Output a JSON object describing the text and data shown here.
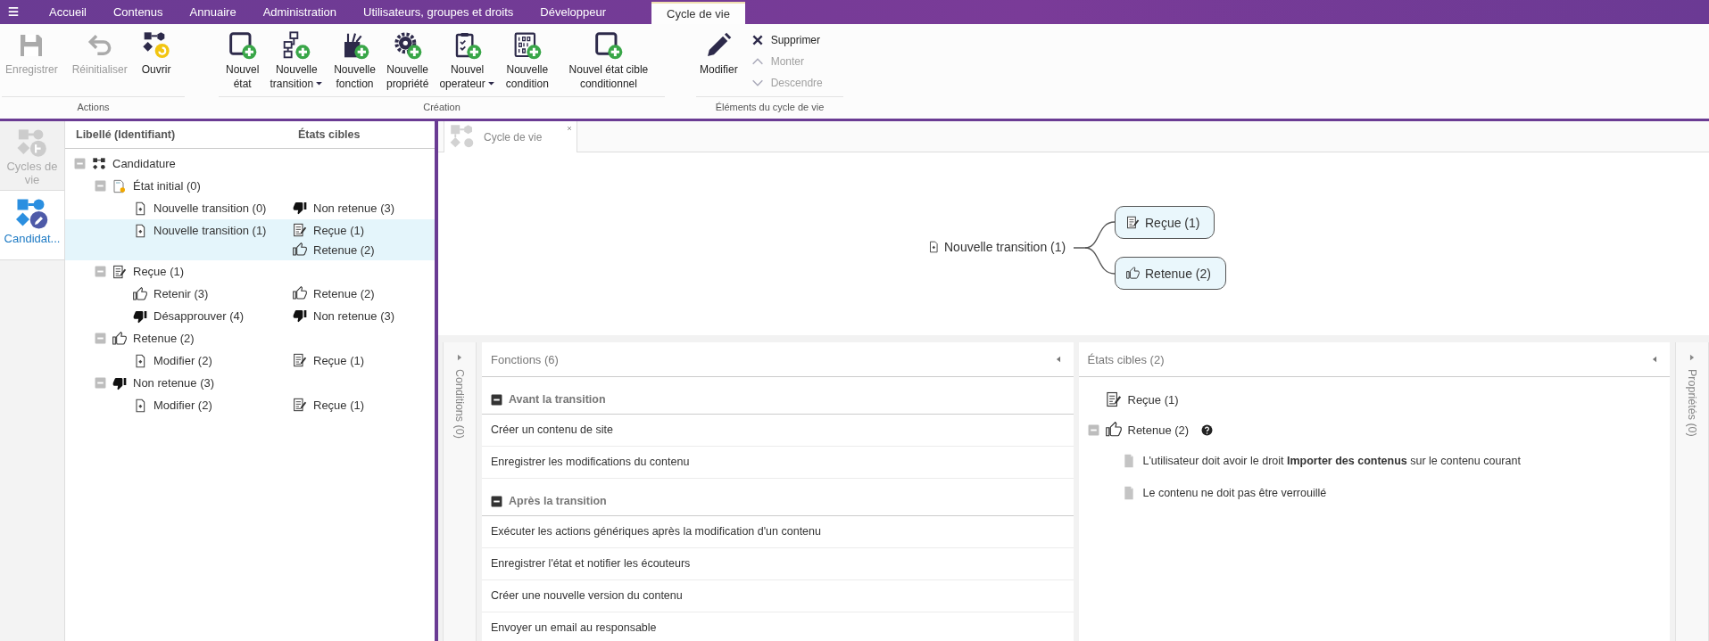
{
  "top_tabs": [
    {
      "label": "Accueil",
      "selected": false
    },
    {
      "label": "Contenus",
      "selected": false
    },
    {
      "label": "Annuaire",
      "selected": false
    },
    {
      "label": "Administration",
      "selected": false
    },
    {
      "label": "Utilisateurs, groupes et droits",
      "selected": false
    },
    {
      "label": "Développeur",
      "selected": false
    },
    {
      "label": "Cycle de vie",
      "selected": true
    }
  ],
  "ribbon": {
    "groups": [
      {
        "label": "Actions",
        "buttons": [
          {
            "label": "Enregistrer",
            "kind": "save",
            "disabled": true,
            "dropdown": false
          },
          {
            "label": "Réinitialiser",
            "kind": "undo",
            "disabled": true,
            "dropdown": false
          },
          {
            "label": "Ouvrir",
            "kind": "open",
            "disabled": false,
            "dropdown": false
          }
        ]
      },
      {
        "label": "Création",
        "buttons": [
          {
            "label": "Nouvel état",
            "kind": "state-add",
            "disabled": false,
            "dropdown": false
          },
          {
            "label": "Nouvelle transition",
            "kind": "transition-add",
            "disabled": false,
            "dropdown": true
          },
          {
            "label": "Nouvelle fonction",
            "kind": "function-add",
            "disabled": false,
            "dropdown": false
          },
          {
            "label": "Nouvelle propriété",
            "kind": "property-add",
            "disabled": false,
            "dropdown": false
          },
          {
            "label": "Nouvel operateur",
            "kind": "operator-add",
            "disabled": false,
            "dropdown": true
          },
          {
            "label": "Nouvelle condition",
            "kind": "condition-add",
            "disabled": false,
            "dropdown": false
          },
          {
            "label": "Nouvel état cible conditionnel",
            "kind": "state-add",
            "disabled": false,
            "dropdown": false
          }
        ]
      },
      {
        "label": "Éléments du cycle de vie",
        "buttons": [
          {
            "label": "Modifier",
            "kind": "pencil",
            "disabled": false,
            "dropdown": false
          }
        ],
        "small_buttons": [
          {
            "label": "Supprimer",
            "kind": "x",
            "disabled": false
          },
          {
            "label": "Monter",
            "kind": "chevron-up",
            "disabled": true
          },
          {
            "label": "Descendre",
            "kind": "chevron-down",
            "disabled": true
          }
        ]
      }
    ]
  },
  "side_tabs": [
    {
      "label": "Cycles de vie",
      "kind": "flow-cycle",
      "selected": false
    },
    {
      "label": "Candidat...",
      "kind": "flow-edit",
      "selected": true
    }
  ],
  "tree": {
    "columns": [
      "Libellé (Identifiant)",
      "États cibles"
    ],
    "nodes": [
      {
        "label": "Candidature",
        "kind": "flow",
        "expanded": true,
        "selected": false,
        "children": [
          {
            "label": "État initial (0)",
            "kind": "initial",
            "expanded": true,
            "selected": false,
            "children": [
              {
                "label": "Nouvelle transition (0)",
                "kind": "transition",
                "selected": false,
                "targets": [
                  {
                    "label": "Non retenue (3)",
                    "kind": "thumbs-down"
                  }
                ]
              },
              {
                "label": "Nouvelle transition (1)",
                "kind": "transition",
                "selected": true,
                "targets": [
                  {
                    "label": "Reçue (1)",
                    "kind": "received"
                  },
                  {
                    "label": "Retenue (2)",
                    "kind": "thumbs-up"
                  }
                ]
              }
            ]
          },
          {
            "label": "Reçue (1)",
            "kind": "received",
            "expanded": true,
            "selected": false,
            "children": [
              {
                "label": "Retenir (3)",
                "kind": "thumbs-up",
                "selected": false,
                "targets": [
                  {
                    "label": "Retenue (2)",
                    "kind": "thumbs-up"
                  }
                ]
              },
              {
                "label": "Désapprouver (4)",
                "kind": "thumbs-down",
                "selected": false,
                "targets": [
                  {
                    "label": "Non retenue (3)",
                    "kind": "thumbs-down"
                  }
                ]
              }
            ]
          },
          {
            "label": "Retenue (2)",
            "kind": "thumbs-up",
            "expanded": true,
            "selected": false,
            "children": [
              {
                "label": "Modifier (2)",
                "kind": "transition",
                "selected": false,
                "targets": [
                  {
                    "label": "Reçue (1)",
                    "kind": "received"
                  }
                ]
              }
            ]
          },
          {
            "label": "Non retenue (3)",
            "kind": "thumbs-down",
            "expanded": true,
            "selected": false,
            "children": [
              {
                "label": "Modifier (2)",
                "kind": "transition",
                "selected": false,
                "targets": [
                  {
                    "label": "Reçue (1)",
                    "kind": "received"
                  }
                ]
              }
            ]
          }
        ]
      }
    ]
  },
  "graph_tab": {
    "label": "Cycle de vie"
  },
  "graph": {
    "source": {
      "label": "Nouvelle transition (1)",
      "kind": "transition"
    },
    "targets": [
      {
        "label": "Reçue (1)",
        "kind": "received"
      },
      {
        "label": "Retenue (2)",
        "kind": "thumbs-up"
      }
    ]
  },
  "conditions_panel": {
    "label": "Conditions (0)"
  },
  "functions_panel": {
    "title": "Fonctions (6)",
    "sections": [
      {
        "title": "Avant la transition",
        "expanded": true,
        "items": [
          "Créer un contenu de site",
          "Enregistrer les modifications du contenu"
        ]
      },
      {
        "title": "Après la transition",
        "expanded": true,
        "items": [
          "Exécuter les actions génériques après la modification d'un contenu",
          "Enregistrer l'état et notifier les écouteurs",
          "Créer une nouvelle version du contenu",
          "Envoyer un email au responsable"
        ]
      }
    ]
  },
  "targets_panel": {
    "title": "États cibles (2)",
    "items": [
      {
        "label": "Reçue (1)",
        "kind": "received"
      },
      {
        "label": "Retenue (2)",
        "kind": "thumbs-up",
        "expanded": true,
        "help": true,
        "conditions": [
          "L'utilisateur doit avoir le droit **Importer des contenus** sur le contenu courant",
          "Le contenu ne doit pas être verrouillé"
        ]
      }
    ]
  },
  "properties_panel": {
    "label": "Propriétés (0)"
  }
}
